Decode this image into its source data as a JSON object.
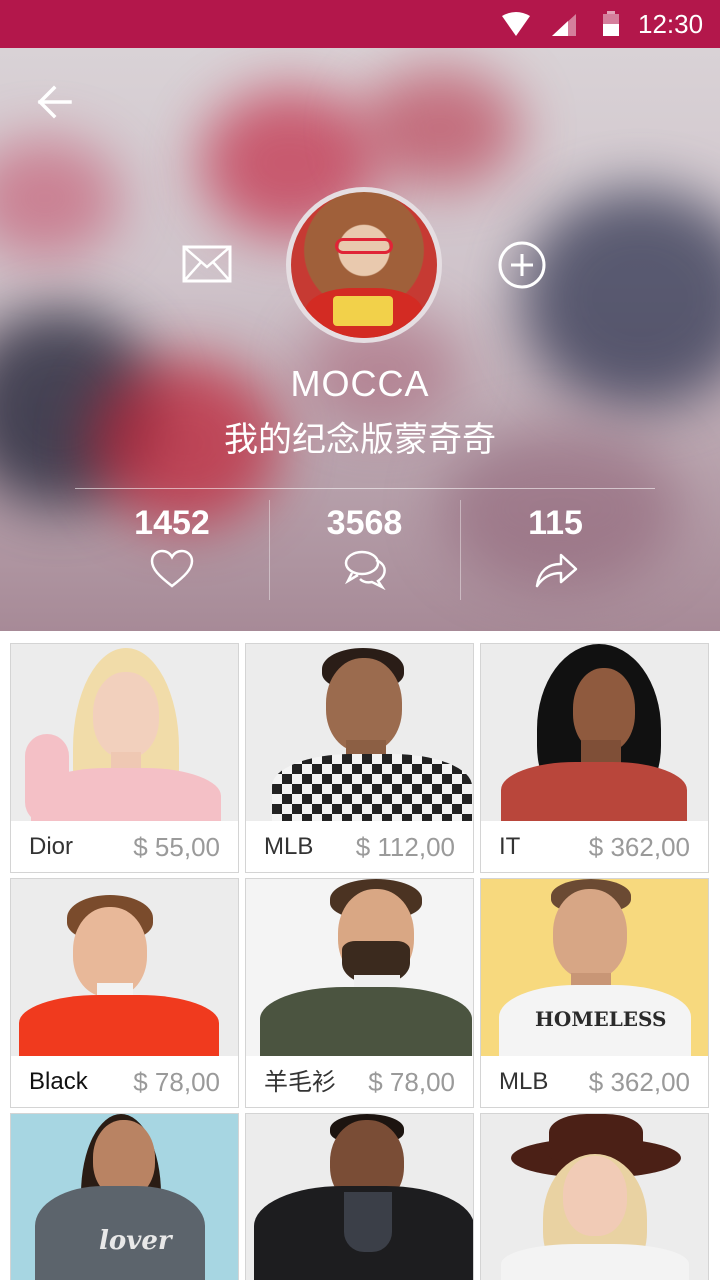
{
  "status_bar": {
    "time": "12:30",
    "bar_color": "#b3174b"
  },
  "profile": {
    "username": "MOCCA",
    "bio": "我的纪念版蒙奇奇",
    "stats": [
      {
        "value": "1452",
        "icon": "heart-icon"
      },
      {
        "value": "3568",
        "icon": "comment-icon"
      },
      {
        "value": "115",
        "icon": "share-icon"
      }
    ],
    "icons": {
      "back": "arrow-left-icon",
      "message": "envelope-icon",
      "follow": "plus-circle-icon"
    }
  },
  "products": [
    {
      "name": "Dior",
      "price": "$ 55,00"
    },
    {
      "name": "MLB",
      "price": "$ 112,00"
    },
    {
      "name": "IT",
      "price": "$ 362,00"
    },
    {
      "name": "Black",
      "price": "$ 78,00"
    },
    {
      "name": "羊毛衫",
      "price": "$ 78,00"
    },
    {
      "name": "MLB",
      "price": "$ 362,00"
    },
    {
      "name": "",
      "price": ""
    },
    {
      "name": "",
      "price": ""
    },
    {
      "name": "",
      "price": ""
    }
  ],
  "product_print": {
    "tee_text": "HOMELESS",
    "sweater_text": "lover"
  }
}
